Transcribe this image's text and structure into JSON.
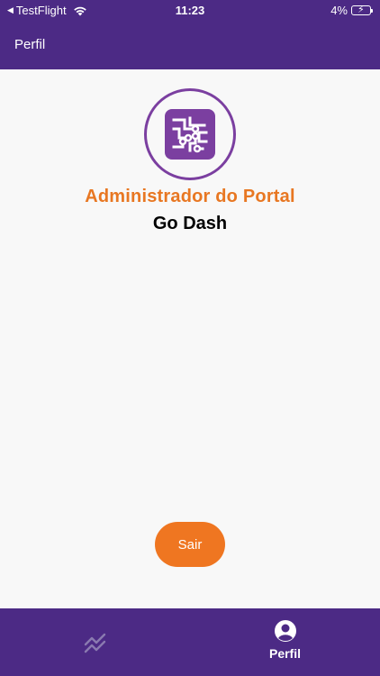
{
  "status_bar": {
    "back_arrow": "◀",
    "carrier": "TestFlight",
    "time": "11:23",
    "battery": "4%",
    "icons": [
      "wifi-icon",
      "battery-charging-icon"
    ]
  },
  "header": {
    "title": "Perfil"
  },
  "profile": {
    "avatar_icon": "circuit-chip-icon",
    "role": "Administrador do Portal",
    "name": "Go Dash"
  },
  "actions": {
    "logout_label": "Sair"
  },
  "tabbar": {
    "tabs": [
      {
        "label": "",
        "icon": "trend-chart-icon",
        "active": false
      },
      {
        "label": "Perfil",
        "icon": "user-circle-icon",
        "active": true
      }
    ]
  },
  "colors": {
    "primary": "#4c2a85",
    "accent": "#ef7621",
    "role_text": "#e87722",
    "avatar_border": "#7b3fa0",
    "background": "#f8f8f8"
  }
}
